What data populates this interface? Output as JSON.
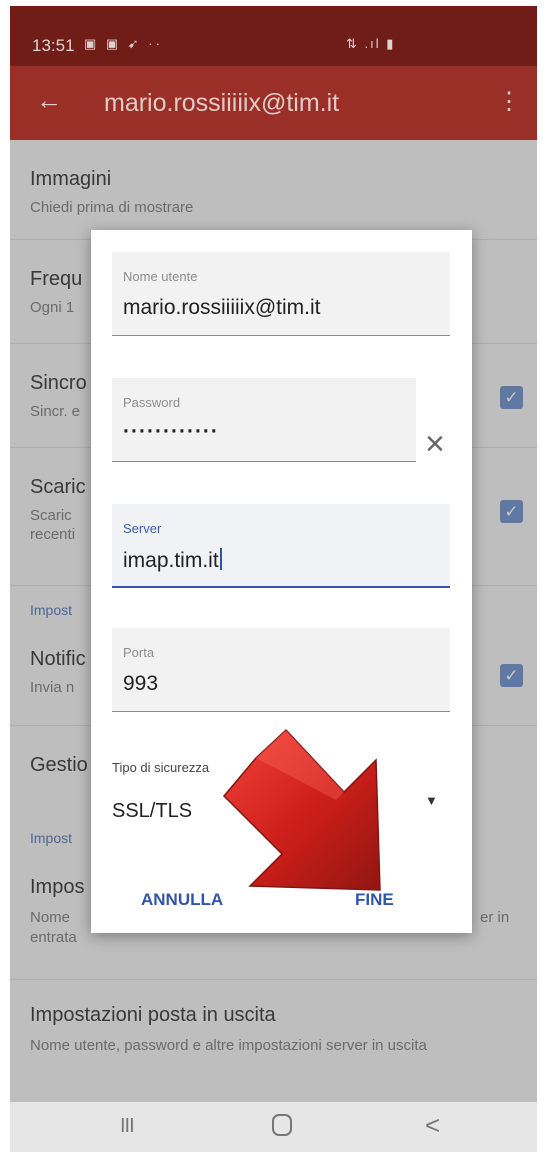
{
  "status_bar": {
    "time": "13:51",
    "left_icons": "▣ ▣ ➹ ··",
    "right_icons": "⇅ .ıl ▮"
  },
  "app_bar": {
    "title": "mario.rossiiiiix@tim.it",
    "back_icon": "arrow-left-icon",
    "overflow_icon": "more-vert-icon"
  },
  "settings": {
    "images_title": "Immagini",
    "images_sub": "Chiedi prima di mostrare",
    "frequency_title": "Frequ",
    "frequency_sub": "Ogni 1",
    "sync_title": "Sincro",
    "sync_sub": "Sincr. e",
    "download_title": "Scaric",
    "download_sub_1": "Scaric",
    "download_sub_2": "recenti",
    "section_1": "Impost",
    "notif_title": "Notific",
    "notif_sub": "Invia n",
    "manage_title": "Gestio",
    "section_2": "Impost",
    "incoming_title": "Impos",
    "incoming_sub_1": "Nome",
    "incoming_sub_right": "er in",
    "incoming_sub_2": "entrata",
    "outgoing_title": "Impostazioni posta in uscita",
    "outgoing_sub": "Nome utente, password e altre impostazioni server in uscita"
  },
  "dialog": {
    "username_label": "Nome utente",
    "username_value": "mario.rossiiiiix@tim.it",
    "password_label": "Password",
    "password_value": "············",
    "server_label": "Server",
    "server_value": "imap.tim.it",
    "port_label": "Porta",
    "port_value": "993",
    "security_label": "Tipo di sicurezza",
    "security_value": "SSL/TLS",
    "cancel_label": "ANNULLA",
    "done_label": "FINE"
  },
  "nav_bar": {
    "recents": "III",
    "back": "<"
  },
  "colors": {
    "app_bar": "#a8342c",
    "status_bar": "#7a1f1a",
    "accent": "#3355a8",
    "arrow": "#d11a12"
  }
}
